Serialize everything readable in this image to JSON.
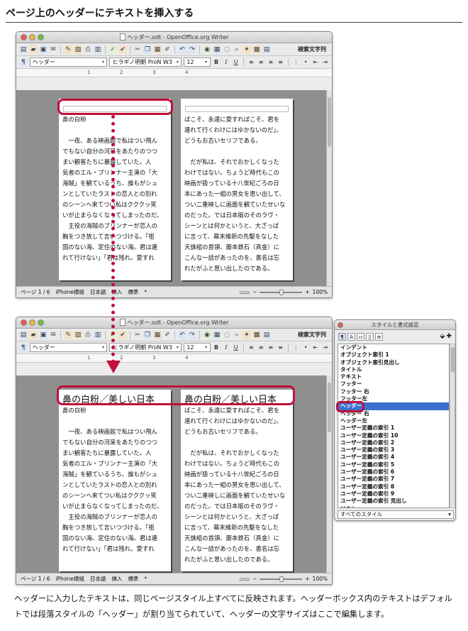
{
  "heading": "ページ上のヘッダーにテキストを挿入する",
  "window": {
    "title": "ヘッダー.odt - OpenOffice.org Writer",
    "search_label": "検索文字列",
    "toolbar_icons": [
      "new-icon",
      "open-icon",
      "save-icon",
      "email-icon",
      "edit-icon",
      "export-pdf-icon",
      "print-icon",
      "preview-icon",
      "spellcheck-icon",
      "autospell-icon",
      "cut-icon",
      "copy-icon",
      "paste-icon",
      "format-paint-icon",
      "undo-icon",
      "redo-icon",
      "hyperlink-icon",
      "table-icon",
      "draw-icon",
      "find-icon",
      "navigator-icon",
      "gallery-icon",
      "datasource-icon"
    ],
    "paragraph_style": "ヘッダー",
    "font_name": "ヒラギノ明朝 ProN W3",
    "font_size": "12",
    "ruler_marks": [
      "1",
      "2",
      "3",
      "4"
    ],
    "status": {
      "page": "ページ 1 / 6",
      "layout": "iPhone横組",
      "language": "日本語",
      "mode": "挿入",
      "selection": "標準",
      "modified": "*",
      "zoom": "100%"
    }
  },
  "pages": {
    "left_body": "鼻の白粉\n\n　一夜、ある映画館で私はつい飛ん\nでもない自分の河呆をあたりのつつ\nまい観客たちに暴露していた。人\n気者のエル・プリンナー主演の「大\n海賊」を観ているうち、誰もがシュ\nンとしていたラストの恋人との別れ\nのシーンへ来てつい私はクククッ笑\nいが止まらなくなってしまったのだ。\n　主役の海賊のブリンナーが恋人の\n胸をつき放して言いつづける。「祖\n国のない海、定住のない海。君は連\nれて行けない」「君は残れ。愛すれ",
    "right_body": "ばこそ、永遠に愛すればこそ、君を\n連れて行くわけにはゆかないのだ」。\nどうもお古いセリフである。\n\n　だが私は、それでおかしくなった\nわけではない。ちょうど時代もこの\n映画が扱っている十八世紀ごろの日\n本にあった一組の男女を思い出して、\nつい二重映しに画面を観ていたせいな\nのだった。では日本版のそのラヴ・\nシーンとは何かというと、大ざっぱ\nに言って、幕末維新の先駆をなした\n天誅組の首領、藤本鉄石（真金）に\nこんな一話があったのを、書名は忘\nれたがふと思い出したのである。",
    "header_text": "鼻の白粉／美しい日本"
  },
  "styles_panel": {
    "title": "スタイルと書式設定",
    "items": [
      "インデント",
      "オブジェクト索引 1",
      "オブジェクト索引見出し",
      "タイトル",
      "テキスト",
      "フッター",
      "フッター 右",
      "フッター左",
      "ヘッダー",
      "ヘッダー 右",
      "ヘッダー左",
      "ユーザー定義の索引 1",
      "ユーザー定義の索引 10",
      "ユーザー定義の索引 2",
      "ユーザー定義の索引 3",
      "ユーザー定義の索引 4",
      "ユーザー定義の索引 5",
      "ユーザー定義の索引 6",
      "ユーザー定義の索引 7",
      "ユーザー定義の索引 8",
      "ユーザー定義の索引 9",
      "ユーザー定義の索引 見出し",
      "リスト"
    ],
    "selected": "ヘッダー",
    "filter": "すべてのスタイル"
  },
  "caption": "ヘッダーに入力したテキストは、同じページスタイル上すべてに反映されます。ヘッダーボックス内のテキストはデフォルトでは段落スタイルの「ヘッダー」が割り当てられていて、ヘッダーの文字サイズはここで編集します。",
  "colors": {
    "accent": "#c0103a",
    "selection": "#3b6fd0"
  }
}
